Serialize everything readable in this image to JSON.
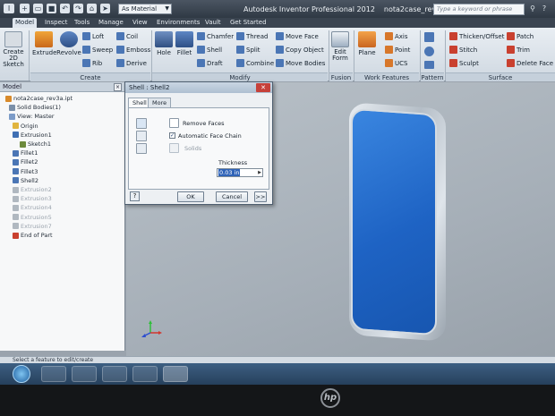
{
  "title_bar": {
    "app_title": "Autodesk Inventor Professional 2012",
    "document": "nota2case_rev3a.ipt",
    "material": "As Material",
    "search_placeholder": "Type a keyword or phrase"
  },
  "tabs": [
    "Model",
    "Inspect",
    "Tools",
    "Manage",
    "View",
    "Environments",
    "Vault",
    "Get Started"
  ],
  "active_tab": "Model",
  "ribbon": {
    "sketch_big": "Create\n2D Sketch",
    "create_big": [
      "Extrude",
      "Revolve"
    ],
    "create_small": [
      "Loft",
      "Sweep",
      "Rib",
      "Coil",
      "Emboss",
      "Derive"
    ],
    "modify_big": [
      "Hole",
      "Fillet"
    ],
    "modify_small": [
      "Chamfer",
      "Shell",
      "Draft",
      "Thread",
      "Split",
      "Combine",
      "Move Face",
      "Copy Object",
      "Move Bodies"
    ],
    "fusion_big": "Edit\nForm",
    "work_big": "Plane",
    "work_small": [
      "Axis",
      "Point",
      "UCS"
    ],
    "surface_small": [
      "Thicken/Offset",
      "Stitch",
      "Sculpt",
      "Patch",
      "Trim",
      "Delete Face"
    ],
    "panels": [
      "Create",
      "Modify",
      "Fusion",
      "Work Features",
      "Pattern",
      "Surface"
    ]
  },
  "browser": {
    "header": "Model",
    "items": [
      {
        "label": "nota2case_rev3a.ipt",
        "dim": false
      },
      {
        "label": "Solid Bodies(1)",
        "dim": false
      },
      {
        "label": "View: Master",
        "dim": false
      },
      {
        "label": "Origin",
        "dim": false
      },
      {
        "label": "Extrusion1",
        "dim": false
      },
      {
        "label": "Sketch1",
        "dim": false
      },
      {
        "label": "Fillet1",
        "dim": false
      },
      {
        "label": "Fillet2",
        "dim": false
      },
      {
        "label": "Fillet3",
        "dim": false
      },
      {
        "label": "Shell2",
        "dim": false
      },
      {
        "label": "Extrusion2",
        "dim": true
      },
      {
        "label": "Extrusion3",
        "dim": true
      },
      {
        "label": "Extrusion4",
        "dim": true
      },
      {
        "label": "Extrusion5",
        "dim": true
      },
      {
        "label": "Extrusion7",
        "dim": true
      },
      {
        "label": "End of Part",
        "dim": false
      }
    ]
  },
  "dialog": {
    "title": "Shell : Shell2",
    "tabs": [
      "Shell",
      "More"
    ],
    "remove_faces": "Remove Faces",
    "auto_face_chain": "Automatic Face Chain",
    "auto_face_chain_checked": true,
    "solids": "Solids",
    "thickness_label": "Thickness",
    "thickness_value": "0.03 in",
    "ok": "OK",
    "cancel": "Cancel",
    "more": ">>",
    "help": "?"
  },
  "status_bar": "Select a feature to edit/create",
  "colors": {
    "face_blue": "#1e63c4",
    "ribbon_bg": "#dfe6ee"
  }
}
